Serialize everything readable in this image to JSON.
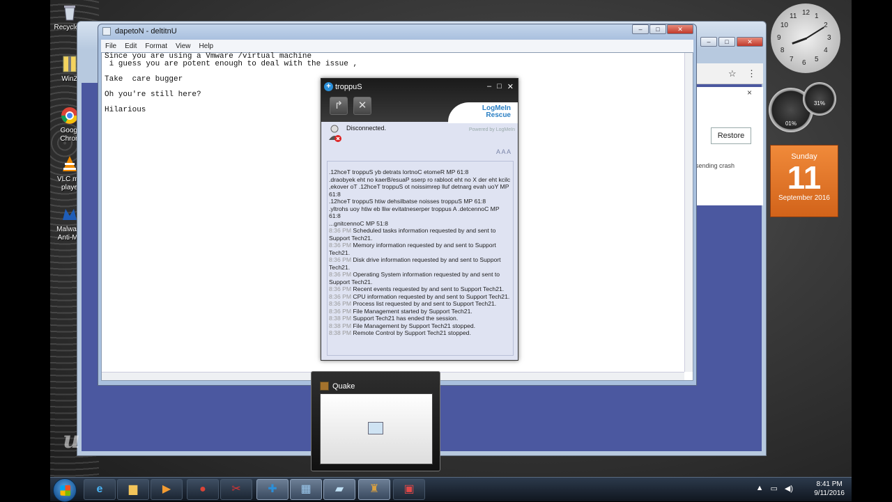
{
  "desktop": {
    "icons": [
      {
        "label": "Recycle B",
        "icon": "recycle-bin-icon"
      },
      {
        "label": "WinZ",
        "icon": "winzip-icon"
      },
      {
        "label": "Googl Chron",
        "icon": "chrome-icon"
      },
      {
        "label": "VLC me playe",
        "icon": "vlc-icon"
      },
      {
        "label": "Malware Anti-Ma",
        "icon": "malwarebytes-icon"
      }
    ]
  },
  "browser": {
    "restore_label": "Restore",
    "crash_text": "sending crash",
    "close_glyph": "×",
    "star_glyph": "☆",
    "menu_glyph": "⋮"
  },
  "notepad": {
    "title": "dapetoN - deltitnU",
    "menu": [
      "File",
      "Edit",
      "Format",
      "View",
      "Help"
    ],
    "text": "Since you are using a Vmware /virtual machine\n i guess you are potent enough to deal with the issue ,\n\nTake  care bugger\n\nOh you're still here?\n\nHilarious"
  },
  "support": {
    "title": "troppuS",
    "logo_line1": "LogMeIn",
    "logo_line2": "Rescue",
    "powered": "Powered by LogMeIn",
    "status": "Disconnected.",
    "font_sizes": "A A A",
    "log": [
      {
        "time": "",
        "text": ".12hceT troppuS yb detrats lortnoC etomeR MP 61:8"
      },
      {
        "time": "",
        "text": ".draobyek eht no kaerB/esuaP sserp ro rabloot eht no X der eht kcilc ,ekover oT .12hceT troppuS ot noissimrep lluf detnarg evah uoY MP 61:8"
      },
      {
        "time": "",
        "text": ".12hceT troppuS htiw dehsilbatse noisses troppuS MP 61:8"
      },
      {
        "time": "",
        "text": ".yltrohs uoy htiw eb lliw evitatneserper troppus A .detcennoC MP 61:8"
      },
      {
        "time": "",
        "text": "...gnitcennoC MP 51:8"
      },
      {
        "time": "8:36 PM",
        "text": "Scheduled tasks information requested by and sent to Support Tech21."
      },
      {
        "time": "8:36 PM",
        "text": "Memory information requested by and sent to Support Tech21."
      },
      {
        "time": "8:36 PM",
        "text": "Disk drive information requested by and sent to Support Tech21."
      },
      {
        "time": "8:36 PM",
        "text": "Operating System information requested by and sent to Support Tech21."
      },
      {
        "time": "8:36 PM",
        "text": "Recent events requested by and sent to Support Tech21."
      },
      {
        "time": "8:36 PM",
        "text": "CPU information requested by and sent to Support Tech21."
      },
      {
        "time": "8:36 PM",
        "text": "Process list requested by and sent to Support Tech21."
      },
      {
        "time": "8:36 PM",
        "text": "File Management started by Support Tech21."
      },
      {
        "time": "8:38 PM",
        "text": "Support Tech21 has ended the session."
      },
      {
        "time": "8:38 PM",
        "text": "File Management by Support Tech21 stopped."
      },
      {
        "time": "8:38 PM",
        "text": "Remote Control by Support Tech21 stopped."
      }
    ]
  },
  "gadgets": {
    "clock_numbers": [
      "12",
      "1",
      "2",
      "3",
      "4",
      "5",
      "6",
      "7",
      "8",
      "9",
      "10",
      "11"
    ],
    "meter1_label": "01%",
    "meter2_label": "31%",
    "calendar": {
      "day": "Sunday",
      "date": "11",
      "month": "September 2016"
    }
  },
  "quake": {
    "title": "Quake"
  },
  "taskbar": {
    "time": "8:41 PM",
    "date": "9/11/2016",
    "buttons": [
      "internet-explorer-icon",
      "file-explorer-icon",
      "media-player-icon",
      "chrome-icon",
      "snipping-tool-icon",
      "logmein-icon",
      "remote-icon",
      "notepad-icon",
      "quake-icon",
      "toolbox-icon"
    ]
  },
  "windows_controls": {
    "min": "–",
    "max": "□",
    "close": "✕"
  }
}
